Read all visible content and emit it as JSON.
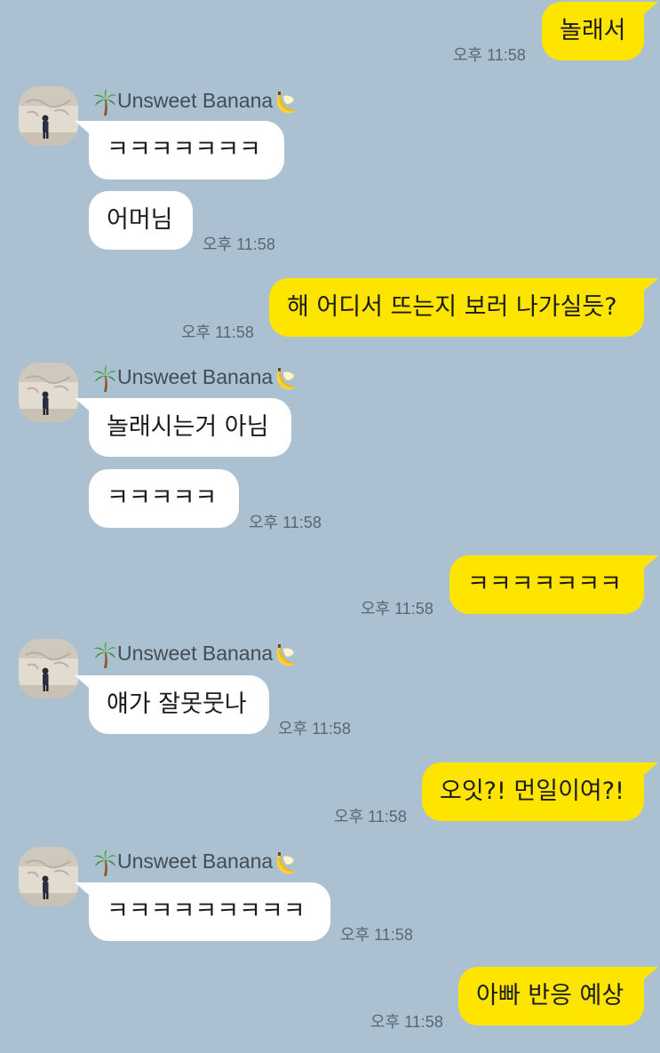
{
  "sender": {
    "name": "Unsweet Banana",
    "prefix_icon": "palm-tree-icon",
    "suffix_icon": "banana-icon"
  },
  "colors": {
    "background": "#abc1d1",
    "mine_bubble": "#fee500",
    "their_bubble": "#ffffff"
  },
  "messages": [
    {
      "from": "me",
      "text": "놀래서",
      "time": "오후 11:58"
    },
    {
      "from": "them",
      "text": "ㅋㅋㅋㅋㅋㅋㅋ"
    },
    {
      "from": "them",
      "text": "어머님",
      "time": "오후 11:58"
    },
    {
      "from": "me",
      "text": "해 어디서 뜨는지 보러 나가실듯?",
      "time": "오후 11:58"
    },
    {
      "from": "them",
      "text": "놀래시는거 아님"
    },
    {
      "from": "them",
      "text": "ㅋㅋㅋㅋㅋ",
      "time": "오후 11:58"
    },
    {
      "from": "me",
      "text": "ㅋㅋㅋㅋㅋㅋㅋ",
      "time": "오후 11:58"
    },
    {
      "from": "them",
      "text": "얘가 잘못뭇나",
      "time": "오후 11:58"
    },
    {
      "from": "me",
      "text": "오잇?! 먼일이여?!",
      "time": "오후 11:58"
    },
    {
      "from": "them",
      "text": "ㅋㅋㅋㅋㅋㅋㅋㅋㅋ",
      "time": "오후 11:58"
    },
    {
      "from": "me",
      "text": "아빠 반응 예상",
      "time": "오후 11:58"
    }
  ]
}
